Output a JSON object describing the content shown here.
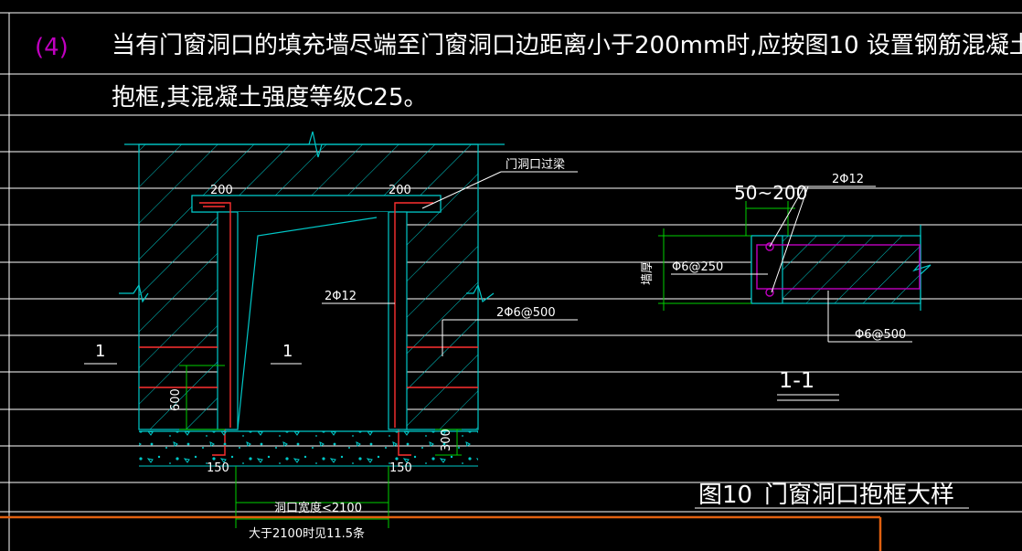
{
  "note": {
    "number": "(4)",
    "line1": "当有门窗洞口的填充墙尽端至门窗洞口边距离小于200mm时,应按图10 设置钢筋混凝土",
    "line2": "抱框,其混凝土强度等级C25。"
  },
  "elevation": {
    "beam_label": "门洞口过梁",
    "dim_left_top": "200",
    "dim_right_top": "200",
    "rebar_label": "2Φ12",
    "stirrup_label": "2Φ6@500",
    "section_left": "1",
    "section_right": "1",
    "dim_600": "600",
    "dim_300": "300",
    "dim_150_left": "150",
    "dim_150_right": "150",
    "opening_width": "洞口宽度<2100",
    "opening_note": "大于2100时见11.5条"
  },
  "section": {
    "spacing": "50~200",
    "rebar": "2Φ12",
    "stirrup": "Φ6@250",
    "stirrup2": "Φ6@500",
    "side_label": "墙厚",
    "title": "1-1"
  },
  "figure": {
    "caption_num": "图10",
    "caption_text": "门窗洞口抱框大样"
  },
  "colors": {
    "background": "#000000",
    "concrete": "#00c8c8",
    "rebar": "#ff3030",
    "dim": "#00d000",
    "section_rebar": "#c000c0",
    "text": "#ffffff",
    "border": "#e06010"
  }
}
